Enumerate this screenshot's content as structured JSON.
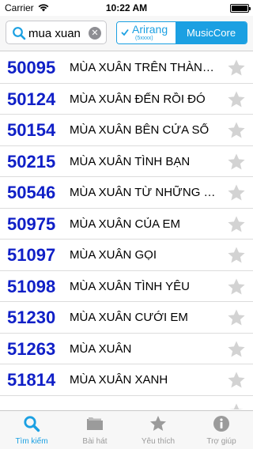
{
  "status_bar": {
    "carrier": "Carrier",
    "time": "10:22 AM"
  },
  "search": {
    "value": "mua xuan",
    "clear_icon": "x-circle-icon"
  },
  "segment": {
    "option_a_title": "Arirang",
    "option_a_sub": "(5xxxx)",
    "option_b": "MusicCore",
    "selected": "Arirang"
  },
  "songs": [
    {
      "code": "50095",
      "title": "MÙA XUÂN TRÊN THÀNH PHỐ HỒ CHÍ MINH"
    },
    {
      "code": "50124",
      "title": "MÙA XUÂN ĐẾN RỒI ĐÓ"
    },
    {
      "code": "50154",
      "title": "MÙA XUÂN BÊN CỬA SỔ"
    },
    {
      "code": "50215",
      "title": "MÙA XUÂN TÌNH BẠN"
    },
    {
      "code": "50546",
      "title": "MÙA XUÂN TỪ NHỮNG GIẾNG DẦU"
    },
    {
      "code": "50975",
      "title": "MÙA XUÂN CỦA EM"
    },
    {
      "code": "51097",
      "title": "MÙA XUÂN GỌI"
    },
    {
      "code": "51098",
      "title": "MÙA XUÂN TÌNH YÊU"
    },
    {
      "code": "51230",
      "title": "MÙA XUÂN CƯỚI EM"
    },
    {
      "code": "51263",
      "title": "MÙA XUÂN"
    },
    {
      "code": "51814",
      "title": "MÙA XUÂN XANH"
    },
    {
      "code": "",
      "title": ""
    }
  ],
  "tabs": [
    {
      "label": "Tìm kiếm",
      "icon": "search-icon",
      "active": true
    },
    {
      "label": "Bài hát",
      "icon": "folder-icon",
      "active": false
    },
    {
      "label": "Yêu thích",
      "icon": "star-icon",
      "active": false
    },
    {
      "label": "Trợ giúp",
      "icon": "info-icon",
      "active": false
    }
  ],
  "colors": {
    "accent": "#1ba0e2",
    "code": "#0f1fc7",
    "star": "#d3d3d3",
    "tab_inactive": "#9b9b9b"
  }
}
